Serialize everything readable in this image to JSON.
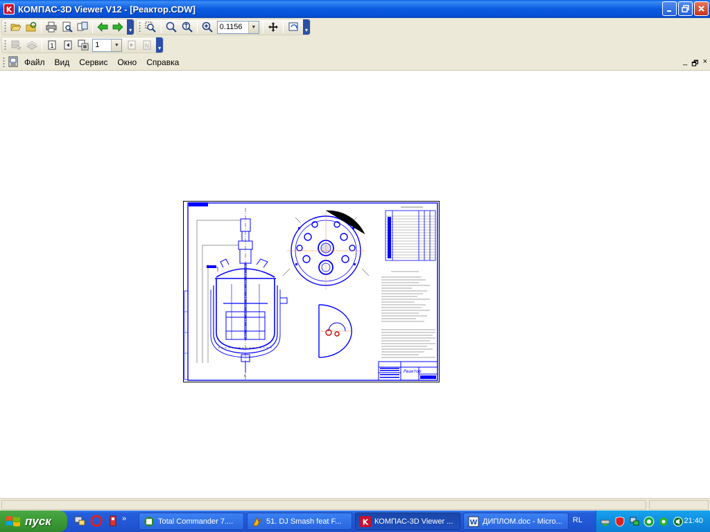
{
  "window": {
    "title": "КОМПАС-3D Viewer V12 - [Реактор.CDW]",
    "accent": "#0a5ae0"
  },
  "toolbar": {
    "zoom_value": "0.1156",
    "page_value": "1"
  },
  "menu": {
    "items": [
      {
        "label": "Файл"
      },
      {
        "label": "Вид"
      },
      {
        "label": "Сервис"
      },
      {
        "label": "Окно"
      },
      {
        "label": "Справка"
      }
    ]
  },
  "mdi": {
    "minimize": "_",
    "restore": "🗗",
    "close": "×"
  },
  "drawing": {
    "title_block_name": "Реактор",
    "line_color": "#0000ff"
  },
  "taskbar": {
    "start_label": "пуск",
    "tasks": [
      {
        "label": "Total Commander 7...."
      },
      {
        "label": "51. DJ Smash feat F..."
      },
      {
        "label": "КОМПАС-3D Viewer ..."
      },
      {
        "label": "ДИПЛОМ.doc - Micro..."
      }
    ],
    "lang": "RL",
    "clock": "21:40"
  }
}
